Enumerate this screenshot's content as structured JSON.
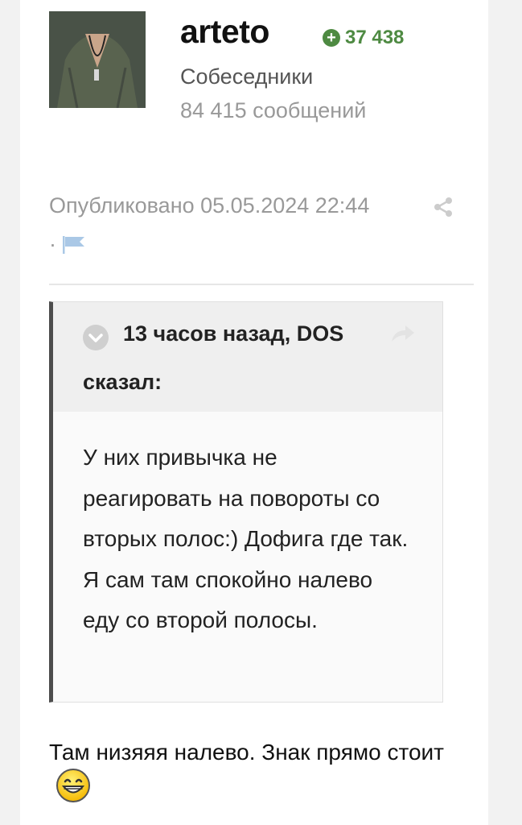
{
  "author": {
    "name": "arteto",
    "reputation": "37 438",
    "group": "Собеседники",
    "posts_count": "84 415 сообщений",
    "avatar_icon": "avatar-man-green-shirt"
  },
  "post": {
    "published": "Опубликовано 05.05.2024 22:44",
    "separator": "·",
    "share_icon": "share-icon",
    "report_icon": "flag-icon"
  },
  "quote": {
    "header_line1": "13 часов назад, DOS",
    "header_line2": "сказал:",
    "body": "У них привычка не реагировать на повороты со вторых полос:) Дофига где так. Я сам там спокойно налево еду со второй полосы."
  },
  "reply": {
    "text": "Там низяяя налево. Знак прямо стоит",
    "emoji_icon": "grinning-emoji"
  },
  "colors": {
    "reputation": "#4e8a42",
    "muted_text": "#999999",
    "quote_border": "#4d4d4d",
    "quote_header_bg": "#efefef"
  }
}
